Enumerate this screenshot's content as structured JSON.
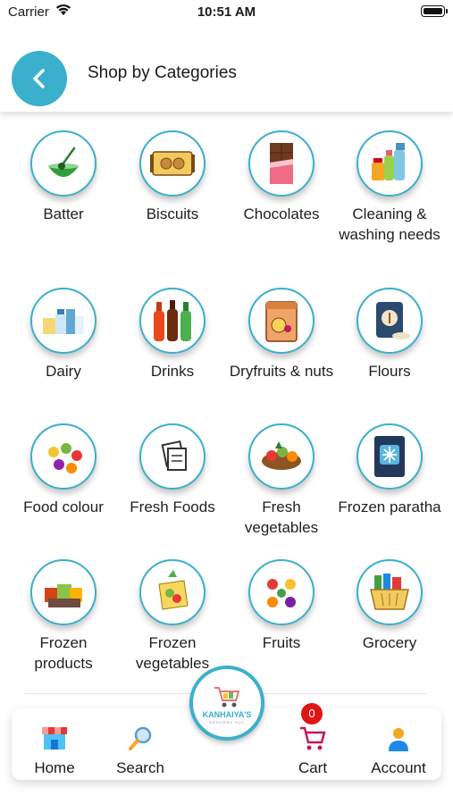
{
  "status_bar": {
    "carrier": "Carrier",
    "time": "10:51 AM"
  },
  "header": {
    "title": "Shop by Categories",
    "back_icon": "chevron-left-icon"
  },
  "categories": [
    {
      "label": "Batter"
    },
    {
      "label": "Biscuits"
    },
    {
      "label": "Chocolates"
    },
    {
      "label": "Cleaning & washing needs"
    },
    {
      "label": "Dairy"
    },
    {
      "label": "Drinks"
    },
    {
      "label": "Dryfruits & nuts"
    },
    {
      "label": "Flours"
    },
    {
      "label": "Food colour"
    },
    {
      "label": "Fresh Foods"
    },
    {
      "label": "Fresh vegetables"
    },
    {
      "label": "Frozen paratha"
    },
    {
      "label": "Frozen products"
    },
    {
      "label": "Frozen vegetables"
    },
    {
      "label": "Fruits"
    },
    {
      "label": "Grocery"
    }
  ],
  "bottom_nav": {
    "home": "Home",
    "search": "Search",
    "logo": "KANHAIYA'S",
    "logo_sub": "GROCERY HUT",
    "cart": "Cart",
    "cart_count": "0",
    "account": "Account"
  },
  "colors": {
    "accent": "#3ab0cc",
    "badge": "#e01515"
  }
}
